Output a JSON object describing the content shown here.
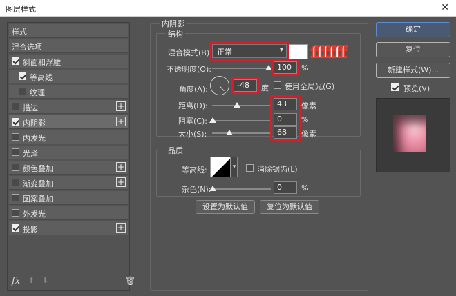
{
  "window": {
    "title": "图层样式",
    "close_glyph": "✕"
  },
  "left": {
    "header": "样式",
    "items": [
      {
        "label": "混合选项",
        "checkbox": false,
        "checked": false,
        "plus": false,
        "selected": false
      },
      {
        "label": "斜面和浮雕",
        "checkbox": true,
        "checked": true,
        "plus": false,
        "selected": false
      },
      {
        "label": "等高线",
        "checkbox": true,
        "checked": true,
        "plus": false,
        "selected": false,
        "indent": true
      },
      {
        "label": "纹理",
        "checkbox": true,
        "checked": false,
        "plus": false,
        "selected": false,
        "indent": true
      },
      {
        "label": "描边",
        "checkbox": true,
        "checked": false,
        "plus": true,
        "selected": false
      },
      {
        "label": "内阴影",
        "checkbox": true,
        "checked": true,
        "plus": true,
        "selected": true
      },
      {
        "label": "内发光",
        "checkbox": true,
        "checked": false,
        "plus": false,
        "selected": false
      },
      {
        "label": "光泽",
        "checkbox": true,
        "checked": false,
        "plus": false,
        "selected": false
      },
      {
        "label": "颜色叠加",
        "checkbox": true,
        "checked": false,
        "plus": true,
        "selected": false
      },
      {
        "label": "渐变叠加",
        "checkbox": true,
        "checked": false,
        "plus": true,
        "selected": false
      },
      {
        "label": "图案叠加",
        "checkbox": true,
        "checked": false,
        "plus": false,
        "selected": false
      },
      {
        "label": "外发光",
        "checkbox": true,
        "checked": false,
        "plus": false,
        "selected": false
      },
      {
        "label": "投影",
        "checkbox": true,
        "checked": true,
        "plus": true,
        "selected": false
      }
    ],
    "plus_glyph": "+",
    "footer": {
      "fx": "fx",
      "up": "⬆",
      "down": "⬇",
      "trash": "🗑"
    }
  },
  "inner_shadow": {
    "title": "内阴影",
    "structure": {
      "title": "结构",
      "blend_mode_label": "混合模式(B):",
      "blend_mode_value": "正常",
      "opacity_label": "不透明度(O):",
      "opacity_value": "100",
      "opacity_unit": "%",
      "angle_label": "角度(A):",
      "angle_value": "-48",
      "angle_unit": "度",
      "global_light_label": "使用全局光(G)",
      "distance_label": "距离(D):",
      "distance_value": "43",
      "distance_unit": "像素",
      "choke_label": "阻塞(C):",
      "choke_value": "0",
      "choke_unit": "%",
      "size_label": "大小(S):",
      "size_value": "68",
      "size_unit": "像素"
    },
    "quality": {
      "title": "品质",
      "contour_label": "等高线:",
      "antialias_label": "消除锯齿(L)",
      "noise_label": "杂色(N):",
      "noise_value": "0",
      "noise_unit": "%"
    },
    "set_default": "设置为默认值",
    "reset_default": "复位为默认值"
  },
  "annotation_text": "ffffff",
  "right": {
    "ok": "确定",
    "reset": "复位",
    "new_style": "新建样式(W)...",
    "preview_label": "预览(V)",
    "preview_checked": true
  },
  "colors": {
    "panel_bg": "#535353",
    "highlight": "#d21f2b",
    "swatch": "#ffffff",
    "accent": "#5b8bd6"
  }
}
